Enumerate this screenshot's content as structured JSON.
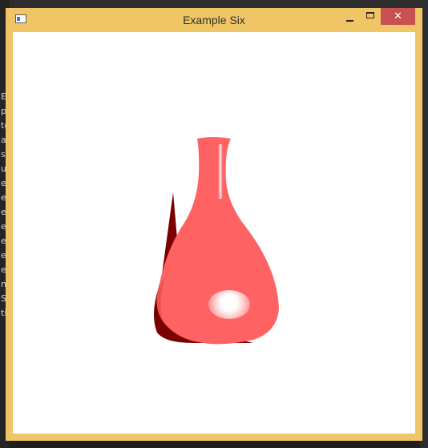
{
  "window": {
    "title": "Example Six",
    "close_glyph": "✕"
  },
  "background_app": {
    "list_items": [
      "Ex",
      "plo",
      "ter",
      "ad",
      "so",
      "ur",
      "e",
      "e",
      "e",
      "e",
      "e",
      "e",
      "e",
      "n",
      "S",
      "ti"
    ]
  },
  "icons": {
    "app": "app-window-icon",
    "minimize": "minimize-icon",
    "maximize": "maximize-icon",
    "close": "close-icon"
  },
  "colors": {
    "title_bar": "#f0c566",
    "close_button": "#c75050",
    "vase_body": "#ff6262",
    "vase_shadow": "#7a0000",
    "highlight": "#ffffff"
  }
}
